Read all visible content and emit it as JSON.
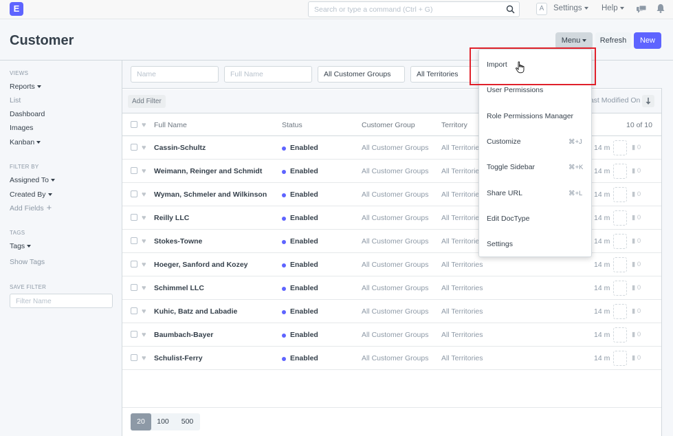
{
  "navbar": {
    "logo_letter": "E",
    "search_placeholder": "Search or type a command (Ctrl + G)",
    "avatar_letter": "A",
    "settings_label": "Settings",
    "help_label": "Help",
    "icons": [
      "search-icon",
      "chat-icon",
      "bell-icon"
    ]
  },
  "page": {
    "title": "Customer",
    "menu_label": "Menu",
    "refresh_label": "Refresh",
    "new_label": "New",
    "accent_color": "#5e64ff"
  },
  "sidebar": {
    "views_heading": "VIEWS",
    "views": [
      "Reports",
      "List",
      "Dashboard",
      "Images",
      "Kanban"
    ],
    "filter_by_heading": "FILTER BY",
    "assigned_to": "Assigned To",
    "created_by": "Created By",
    "add_fields": "Add Fields",
    "tags_heading": "TAGS",
    "tags": "Tags",
    "show_tags": "Show Tags",
    "save_filter_heading": "SAVE FILTER",
    "filter_name_placeholder": "Filter Name"
  },
  "filters": {
    "name_placeholder": "Name",
    "full_name_placeholder": "Full Name",
    "customer_group": "All Customer Groups",
    "territory": "All Territories",
    "add_filter": "Add Filter",
    "sort_label": "Last Modified On"
  },
  "list": {
    "columns": {
      "full_name": "Full Name",
      "status": "Status",
      "customer_group": "Customer Group",
      "territory": "Territory",
      "count": "10 of 10"
    },
    "rows": [
      {
        "name": "Cassin-Schultz",
        "status": "Enabled",
        "group": "All Customer Groups",
        "territory": "All Territories",
        "modified": "14 m",
        "comments": "0"
      },
      {
        "name": "Weimann, Reinger and Schmidt",
        "status": "Enabled",
        "group": "All Customer Groups",
        "territory": "All Territories",
        "modified": "14 m",
        "comments": "0"
      },
      {
        "name": "Wyman, Schmeler and Wilkinson",
        "status": "Enabled",
        "group": "All Customer Groups",
        "territory": "All Territories",
        "modified": "14 m",
        "comments": "0"
      },
      {
        "name": "Reilly LLC",
        "status": "Enabled",
        "group": "All Customer Groups",
        "territory": "All Territories",
        "modified": "14 m",
        "comments": "0"
      },
      {
        "name": "Stokes-Towne",
        "status": "Enabled",
        "group": "All Customer Groups",
        "territory": "All Territories",
        "modified": "14 m",
        "comments": "0"
      },
      {
        "name": "Hoeger, Sanford and Kozey",
        "status": "Enabled",
        "group": "All Customer Groups",
        "territory": "All Territories",
        "modified": "14 m",
        "comments": "0"
      },
      {
        "name": "Schimmel LLC",
        "status": "Enabled",
        "group": "All Customer Groups",
        "territory": "All Territories",
        "modified": "14 m",
        "comments": "0"
      },
      {
        "name": "Kuhic, Batz and Labadie",
        "status": "Enabled",
        "group": "All Customer Groups",
        "territory": "All Territories",
        "modified": "14 m",
        "comments": "0"
      },
      {
        "name": "Baumbach-Bayer",
        "status": "Enabled",
        "group": "All Customer Groups",
        "territory": "All Territories",
        "modified": "14 m",
        "comments": "0"
      },
      {
        "name": "Schulist-Ferry",
        "status": "Enabled",
        "group": "All Customer Groups",
        "territory": "All Territories",
        "modified": "14 m",
        "comments": "0"
      }
    ],
    "page_sizes": [
      "20",
      "100",
      "500"
    ],
    "active_page_size": "20"
  },
  "menu_dropdown": {
    "items": [
      {
        "label": "Import",
        "shortcut": ""
      },
      {
        "label": "User Permissions",
        "shortcut": ""
      },
      {
        "label": "Role Permissions Manager",
        "shortcut": ""
      },
      {
        "label": "Customize",
        "shortcut": "⌘+J"
      },
      {
        "label": "Toggle Sidebar",
        "shortcut": "⌘+K"
      },
      {
        "label": "Share URL",
        "shortcut": "⌘+L"
      },
      {
        "label": "Edit DocType",
        "shortcut": ""
      },
      {
        "label": "Settings",
        "shortcut": ""
      }
    ],
    "highlighted_item": "Import",
    "highlight_color": "#e0202a"
  }
}
